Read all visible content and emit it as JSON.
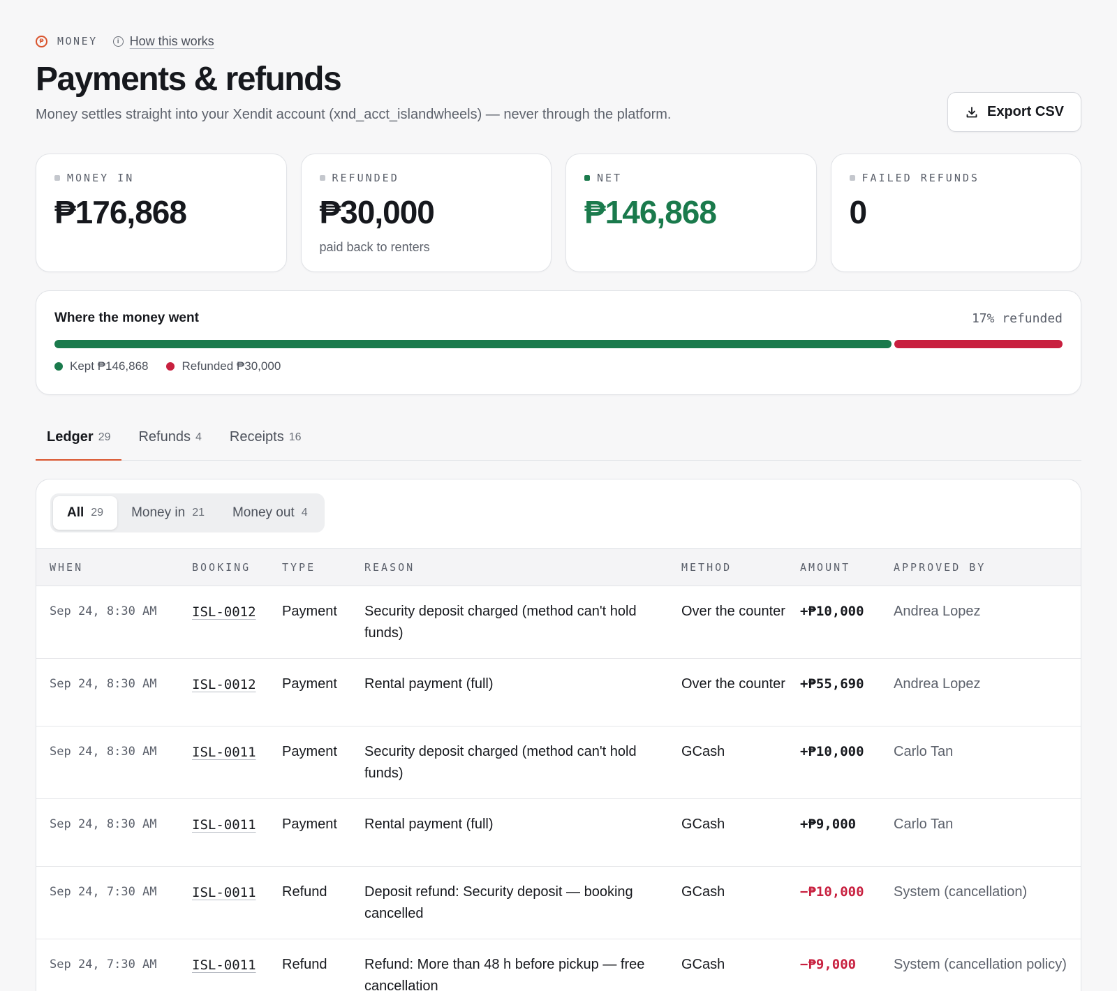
{
  "eyebrow": {
    "section": "MONEY",
    "help_link": "How this works"
  },
  "header": {
    "title": "Payments & refunds",
    "subtitle": "Money settles straight into your Xendit account (xnd_acct_islandwheels) — never through the platform.",
    "export_label": "Export CSV"
  },
  "stats": [
    {
      "label": "MONEY IN",
      "value": "₱176,868",
      "sub": ""
    },
    {
      "label": "REFUNDED",
      "value": "₱30,000",
      "sub": "paid back to renters"
    },
    {
      "label": "NET",
      "value": "₱146,868",
      "sub": ""
    },
    {
      "label": "FAILED REFUNDS",
      "value": "0",
      "sub": ""
    }
  ],
  "money_bar": {
    "title": "Where the money went",
    "refunded_pct_label": "17% refunded",
    "kept_fraction": 0.83,
    "kept_label": "Kept ₱146,868",
    "refunded_label": "Refunded ₱30,000",
    "colors": {
      "kept": "#1a7a4c",
      "refunded": "#c8203f"
    }
  },
  "tabs": [
    {
      "label": "Ledger",
      "count": "29",
      "active": true
    },
    {
      "label": "Refunds",
      "count": "4",
      "active": false
    },
    {
      "label": "Receipts",
      "count": "16",
      "active": false
    }
  ],
  "filters": [
    {
      "label": "All",
      "count": "29",
      "active": true
    },
    {
      "label": "Money in",
      "count": "21",
      "active": false
    },
    {
      "label": "Money out",
      "count": "4",
      "active": false
    }
  ],
  "table": {
    "columns": [
      "WHEN",
      "BOOKING",
      "TYPE",
      "REASON",
      "METHOD",
      "AMOUNT",
      "APPROVED BY"
    ],
    "rows": [
      {
        "when": "Sep 24, 8:30 AM",
        "booking": "ISL-0012",
        "type": "Payment",
        "reason": "Security deposit charged (method can't hold funds)",
        "method": "Over the counter",
        "amount": "+₱10,000",
        "approved_by": "Andrea Lopez"
      },
      {
        "when": "Sep 24, 8:30 AM",
        "booking": "ISL-0012",
        "type": "Payment",
        "reason": "Rental payment (full)",
        "method": "Over the counter",
        "amount": "+₱55,690",
        "approved_by": "Andrea Lopez"
      },
      {
        "when": "Sep 24, 8:30 AM",
        "booking": "ISL-0011",
        "type": "Payment",
        "reason": "Security deposit charged (method can't hold funds)",
        "method": "GCash",
        "amount": "+₱10,000",
        "approved_by": "Carlo Tan"
      },
      {
        "when": "Sep 24, 8:30 AM",
        "booking": "ISL-0011",
        "type": "Payment",
        "reason": "Rental payment (full)",
        "method": "GCash",
        "amount": "+₱9,000",
        "approved_by": "Carlo Tan"
      },
      {
        "when": "Sep 24, 7:30 AM",
        "booking": "ISL-0011",
        "type": "Refund",
        "reason": "Deposit refund: Security deposit — booking cancelled",
        "method": "GCash",
        "amount": "−₱10,000",
        "approved_by": "System (cancellation)"
      },
      {
        "when": "Sep 24, 7:30 AM",
        "booking": "ISL-0011",
        "type": "Refund",
        "reason": "Refund: More than 48 h before pickup — free cancellation",
        "method": "GCash",
        "amount": "−₱9,000",
        "approved_by": "System (cancellation policy)"
      }
    ]
  },
  "colors": {
    "accent": "#d9532c",
    "positive": "#1a7a4c",
    "negative": "#c8203f"
  }
}
